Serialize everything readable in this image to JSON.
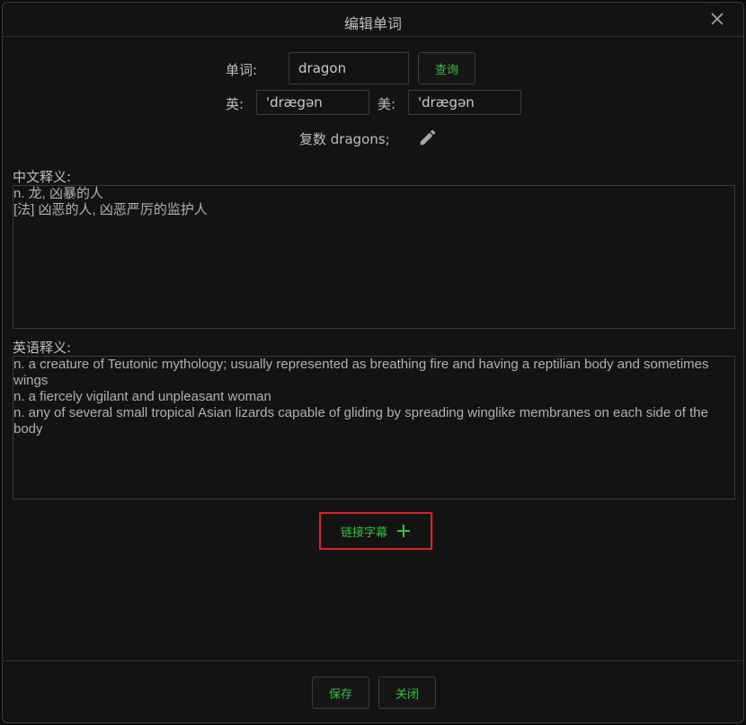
{
  "dialog": {
    "title": "编辑单词"
  },
  "word": {
    "label": "单词:",
    "value": "dragon",
    "lookup_button": "查询"
  },
  "phonetics": {
    "uk_label": "英:",
    "uk_value": "'drægən",
    "us_label": "美:",
    "us_value": "'drægən"
  },
  "forms": {
    "text": "复数 dragons;"
  },
  "chinese_definition": {
    "label": "中文释义:",
    "lines": [
      "n. 龙, 凶暴的人",
      "[法] 凶恶的人, 凶恶严厉的监护人"
    ]
  },
  "english_definition": {
    "label": "英语释义:",
    "lines": [
      "n. a creature of Teutonic mythology; usually represented as breathing fire and having a reptilian body and sometimes wings",
      "n. a fiercely vigilant and unpleasant woman",
      "n. any of several small tropical Asian lizards capable of gliding by spreading winglike membranes on each side of the body"
    ]
  },
  "link_subtitle": {
    "label": "链接字幕"
  },
  "footer": {
    "save_label": "保存",
    "close_label": "关闭"
  },
  "icons": {
    "close": "close-icon",
    "edit": "pencil-icon",
    "add": "plus-icon"
  },
  "colors": {
    "accent_green": "#2fbf3f",
    "highlight_red": "#d92323",
    "background": "#131313"
  }
}
